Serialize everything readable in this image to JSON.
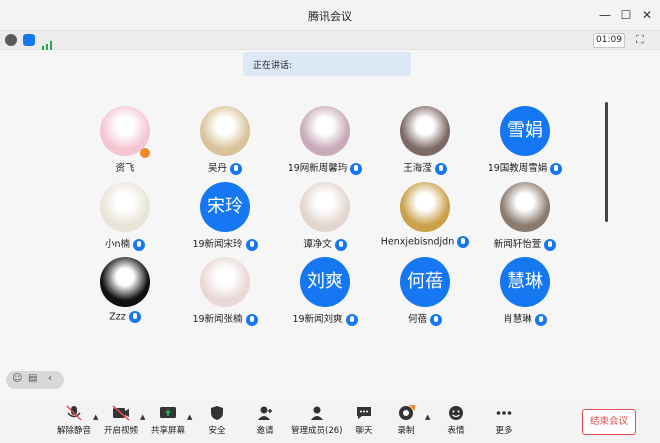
{
  "window": {
    "title": "腾讯会议"
  },
  "infobar": {
    "timer": "01:09"
  },
  "speaking": {
    "label": "正在讲话:"
  },
  "participants": [
    {
      "name": "资飞",
      "avatar_text": "",
      "mic": false,
      "host": true
    },
    {
      "name": "吴丹",
      "avatar_text": "",
      "mic": true,
      "host": false
    },
    {
      "name": "19网新周馨玙",
      "avatar_text": "",
      "mic": true,
      "host": false
    },
    {
      "name": "王海滢",
      "avatar_text": "",
      "mic": true,
      "host": false
    },
    {
      "name": "19国教周雪娟",
      "avatar_text": "雪娟",
      "mic": true,
      "host": false
    },
    {
      "name": "小n楠",
      "avatar_text": "",
      "mic": true,
      "host": false
    },
    {
      "name": "19新闻宋玲",
      "avatar_text": "宋玲",
      "mic": true,
      "host": false
    },
    {
      "name": "谭净文",
      "avatar_text": "",
      "mic": true,
      "host": false
    },
    {
      "name": "Henxjebisndjdn",
      "avatar_text": "",
      "mic": true,
      "host": false
    },
    {
      "name": "新闻轩怡萱",
      "avatar_text": "",
      "mic": true,
      "host": false
    },
    {
      "name": "Zzz",
      "avatar_text": "",
      "mic": true,
      "host": false
    },
    {
      "name": "19新闻张楠",
      "avatar_text": "",
      "mic": true,
      "host": false
    },
    {
      "name": "19新闻刘爽",
      "avatar_text": "刘爽",
      "mic": true,
      "host": false
    },
    {
      "name": "何蓓",
      "avatar_text": "何蓓",
      "mic": true,
      "host": false
    },
    {
      "name": "肖慧琳",
      "avatar_text": "慧琳",
      "mic": true,
      "host": false
    }
  ],
  "toolbar": {
    "unmute": "解除静音",
    "video": "开启视频",
    "share": "共享屏幕",
    "security": "安全",
    "invite": "邀请",
    "members": "管理成员(26)",
    "chat": "聊天",
    "record": "录制",
    "reactions": "表情",
    "more": "更多",
    "end": "结束会议"
  },
  "colors": {
    "accent": "#1677f2",
    "end": "#e34d4d",
    "host_badge": "#f08a24"
  }
}
